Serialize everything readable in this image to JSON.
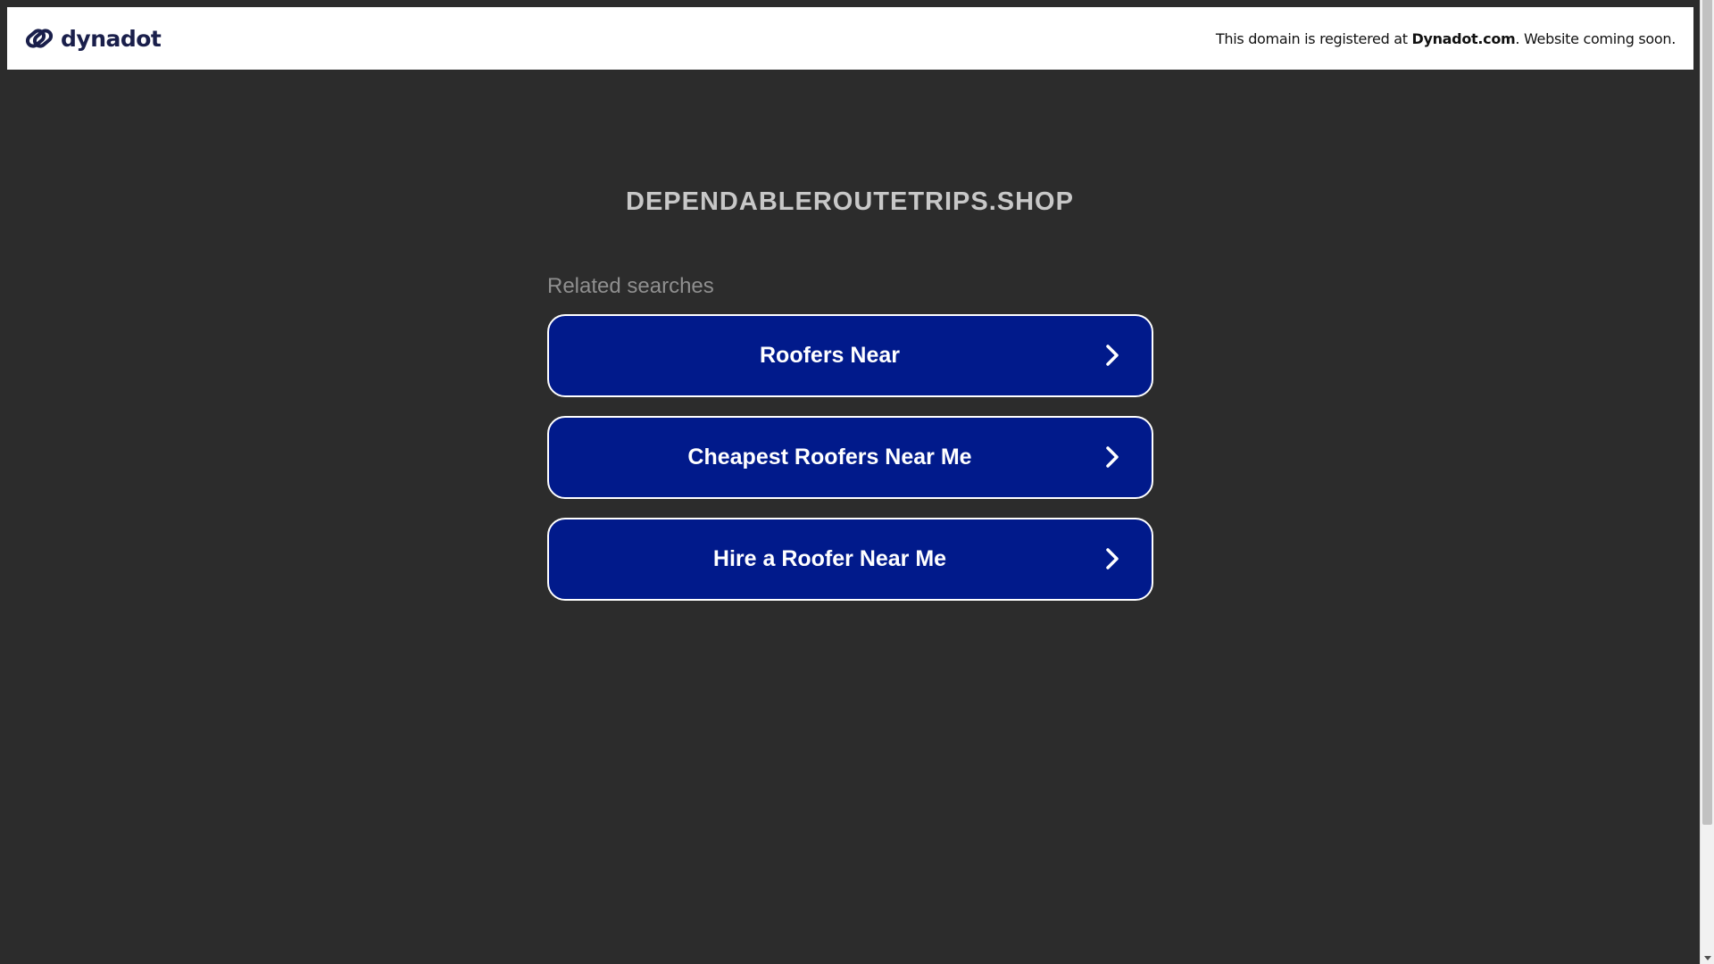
{
  "banner": {
    "brand_name": "dynadot",
    "notice_prefix": "This domain is registered at ",
    "notice_registrar": "Dynadot.com",
    "notice_suffix": ". Website coming soon.",
    "brand_icon": "dynadot-logo-icon"
  },
  "main": {
    "domain": "DEPENDABLEROUTETRIPS.SHOP",
    "related_label": "Related searches",
    "searches": [
      {
        "label": "Roofers Near",
        "icon": "chevron-right-icon"
      },
      {
        "label": "Cheapest Roofers Near Me",
        "icon": "chevron-right-icon"
      },
      {
        "label": "Hire a Roofer Near Me",
        "icon": "chevron-right-icon"
      }
    ]
  },
  "colors": {
    "background": "#2c2c2c",
    "button_bg": "#011a8b",
    "button_border": "#ffffff",
    "brand": "#1a1f4b",
    "domain_text": "#c8c8c8",
    "related_text": "#8f8f8f"
  }
}
